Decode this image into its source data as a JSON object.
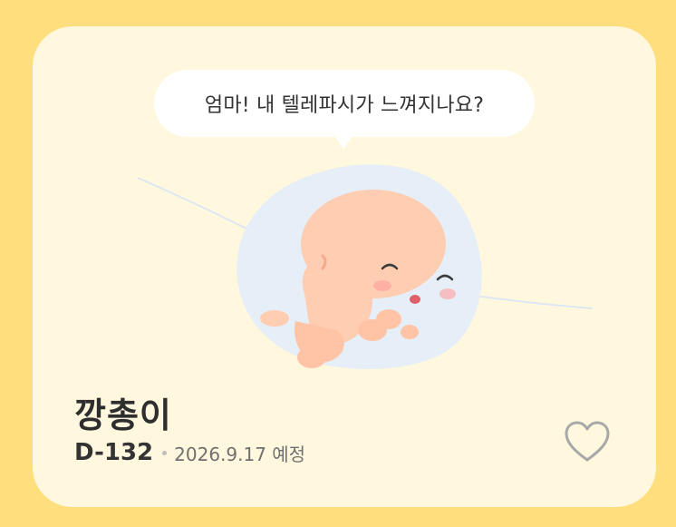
{
  "bubble": {
    "text": "엄마! 내 텔레파시가 느껴지나요?"
  },
  "baby": {
    "name": "깡총이",
    "dday": "D-132",
    "due_date": "2026.9.17 예정"
  },
  "icons": {
    "favorite": "heart-icon"
  },
  "colors": {
    "background": "#FFDE7D",
    "card": "#FFF8DF",
    "womb": "#E6EEF8",
    "skin": "#FFCDB2"
  }
}
